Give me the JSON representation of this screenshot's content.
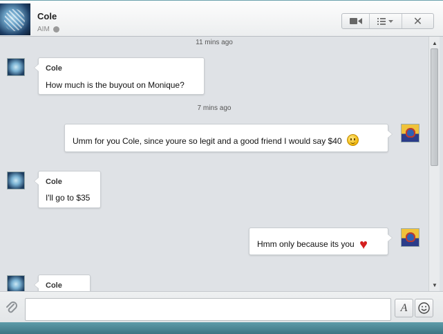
{
  "header": {
    "contact_name": "Cole",
    "service": "AIM"
  },
  "messages": [
    {
      "type": "timestamp",
      "text": "11 mins ago"
    },
    {
      "type": "incoming",
      "sender": "Cole",
      "text": "How much is the buyout on Monique?"
    },
    {
      "type": "timestamp",
      "text": "7 mins ago"
    },
    {
      "type": "outgoing",
      "text": "Umm for you Cole, since youre so legit and a good friend I would say $40",
      "emoji": "smile-emoji-icon"
    },
    {
      "type": "incoming",
      "sender": "Cole",
      "text": "I'll go to $35"
    },
    {
      "type": "outgoing",
      "text": "Hmm only because its you",
      "emoji": "heart-emoji-icon"
    },
    {
      "type": "incoming",
      "sender": "Cole",
      "text": ""
    }
  ],
  "composer": {
    "value": "",
    "placeholder": ""
  },
  "icons": {
    "video": "video-camera-icon",
    "menu": "list-menu-icon",
    "close": "close-icon",
    "attach": "paperclip-icon",
    "format": "font-format-icon",
    "emoji": "smiley-icon"
  },
  "colors": {
    "chat_background": "#dfe2e6",
    "bubble_background": "#ffffff",
    "status_offline": "#9a9a9a",
    "heart": "#d41f1f",
    "window_frame": "#4a8a9a"
  }
}
